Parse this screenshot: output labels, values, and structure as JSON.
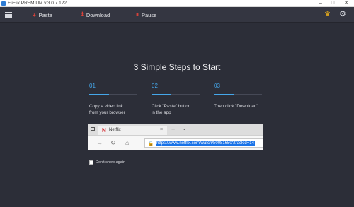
{
  "window": {
    "title": "FliFlik PREMIUM  v.3.0.7.122",
    "minimize": "–",
    "maximize": "□",
    "close": "✕"
  },
  "toolbar": {
    "paste_label": "Paste",
    "paste_icon": "+",
    "download_label": "Download",
    "download_icon": "⭳",
    "pause_label": "Pause",
    "pause_icon": "⏸",
    "crown_icon": "♛",
    "settings_icon": "⚙"
  },
  "main": {
    "title": "3 Simple Steps to Start",
    "steps": [
      {
        "number": "01",
        "line1": "Copy a video link",
        "line2": "from your browser"
      },
      {
        "number": "02",
        "line1": "Click \"Paste\" button",
        "line2": "in the app"
      },
      {
        "number": "03",
        "line1": "Then click \"Download\"",
        "line2": ""
      }
    ],
    "accent_color": "#45a7ea"
  },
  "browser": {
    "tab_logo": "N",
    "tab_title": "Netflix",
    "tab_close": "×",
    "new_tab": "+",
    "tab_menu": "⌄",
    "back": "→",
    "refresh": "↻",
    "home": "⌂",
    "lock": "🔒",
    "url": "https://www.netflix.com/watch/80081650?trackid=14"
  },
  "footer": {
    "dont_show_label": "Don't show again",
    "dont_show_checked": false
  }
}
